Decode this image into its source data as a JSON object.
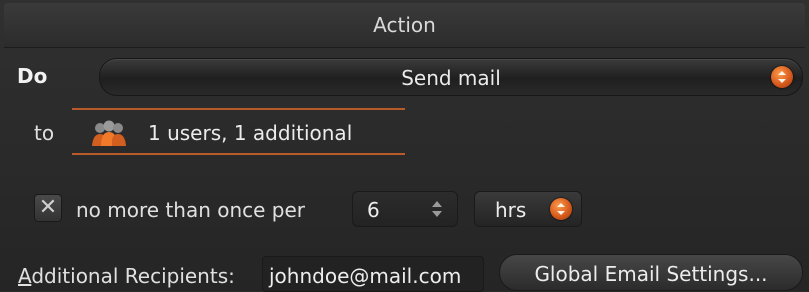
{
  "header": {
    "title": "Action"
  },
  "action": {
    "do_label": "Do",
    "do_value": "Send mail",
    "to_label": "to",
    "recipients_summary": "1 users, 1 additional",
    "recipients_icon": "users-icon"
  },
  "throttle": {
    "checked": true,
    "checkbox_mark": "✕",
    "label": "no more than once per",
    "interval_value": "6",
    "unit_value": "hrs"
  },
  "additional": {
    "label_first": "A",
    "label_rest": "dditional Recipients:",
    "email_value": "johndoe@mail.com"
  },
  "global_button": {
    "label": "Global Email Settings..."
  },
  "colors": {
    "accent": "#d2561a",
    "underline": "#b95a2a",
    "background": "#2a2a2a"
  }
}
